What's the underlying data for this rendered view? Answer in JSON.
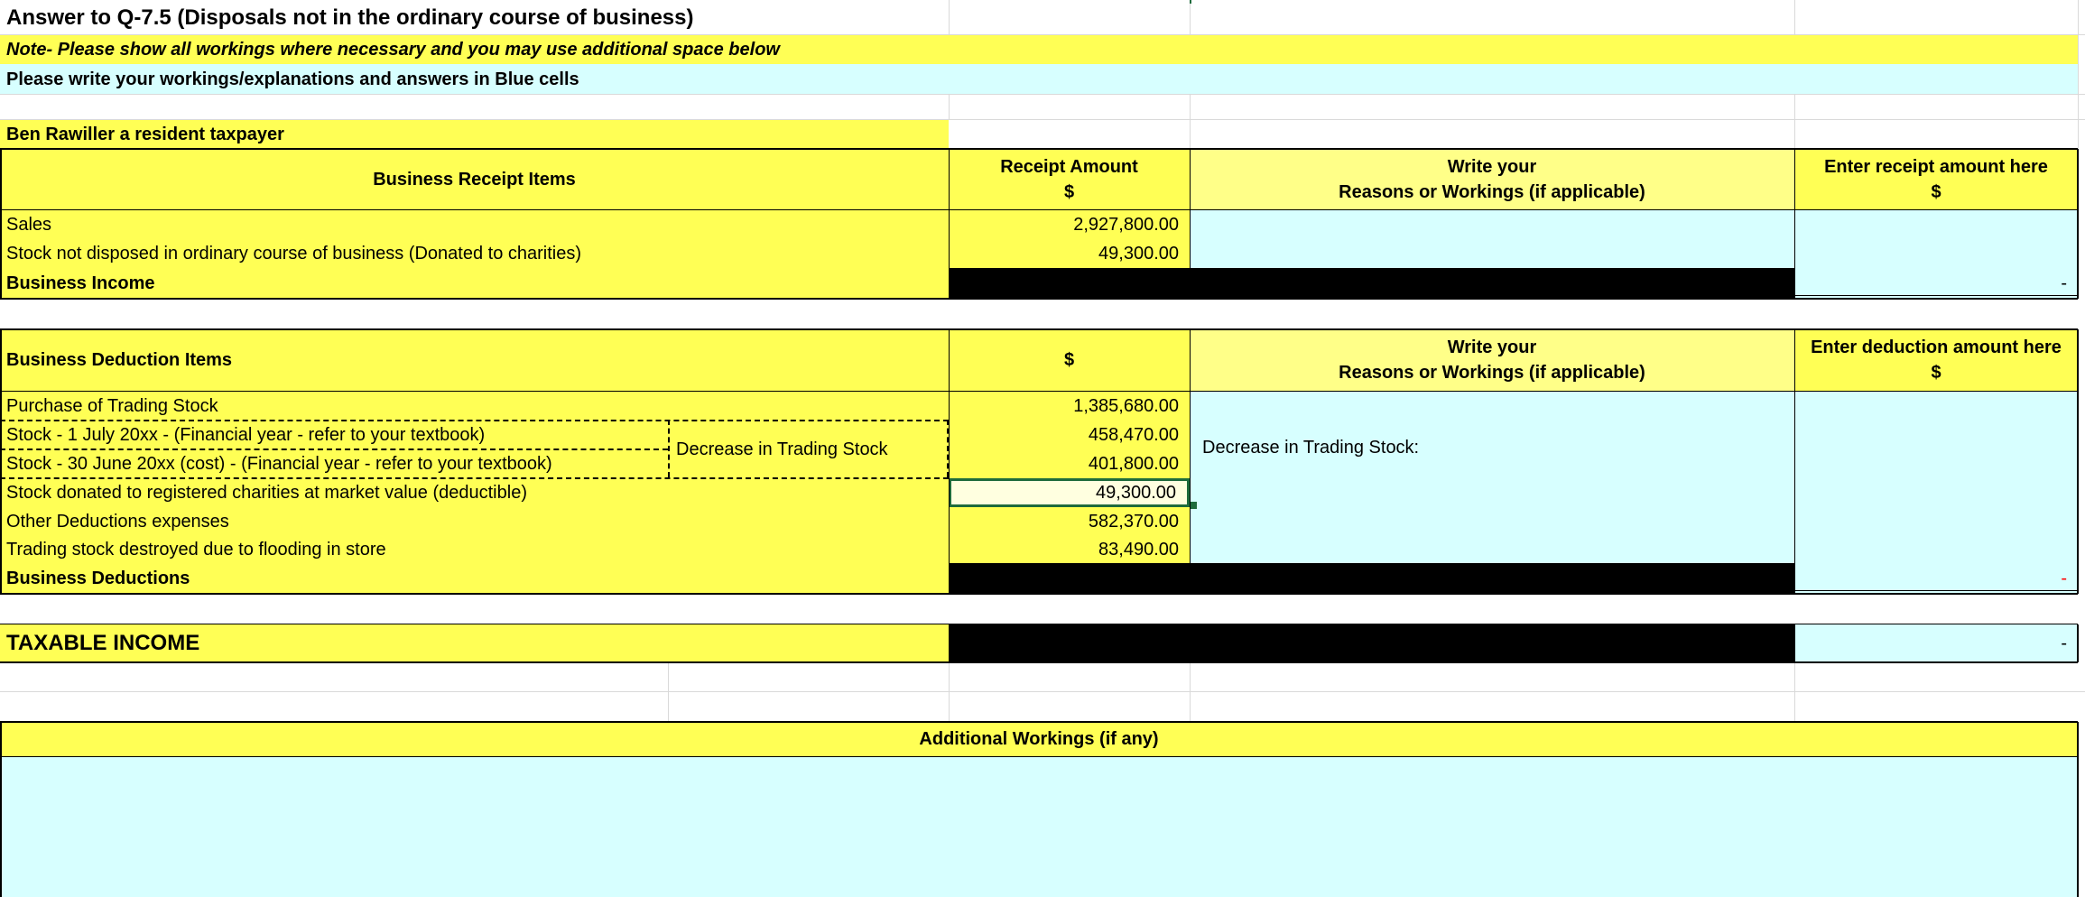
{
  "header": {
    "title": "Answer to Q-7.5 (Disposals not in the ordinary course of business)",
    "note": "Note- Please show all workings where necessary and you may use additional space below",
    "instruction": "Please write your workings/explanations and answers in Blue cells"
  },
  "taxpayer": "Ben Rawiller a resident taxpayer",
  "receipts": {
    "col_items": "Business Receipt Items",
    "col_amount": [
      "Receipt Amount",
      "$"
    ],
    "col_reasons": [
      "Write your",
      "Reasons or Workings (if applicable)"
    ],
    "col_enter": [
      "Enter receipt amount here",
      "$"
    ],
    "rows": [
      {
        "label": "Sales",
        "amount": "2,927,800.00"
      },
      {
        "label": "Stock not disposed in ordinary course of business (Donated to charities)",
        "amount": "49,300.00"
      }
    ],
    "total_label": "Business Income",
    "total_value": "-"
  },
  "deductions": {
    "col_items": "Business Deduction Items",
    "col_amount": "$",
    "col_reasons": [
      "Write your",
      "Reasons or Workings (if applicable)"
    ],
    "col_enter": [
      "Enter deduction amount here",
      "$"
    ],
    "rows": [
      {
        "label": "Purchase of Trading Stock",
        "amount": "1,385,680.00"
      },
      {
        "label": "Stock - 1 July 20xx - (Financial year - refer to your textbook)",
        "amount": "458,470.00"
      },
      {
        "label": "Stock - 30 June 20xx (cost) - (Financial year - refer to your textbook)",
        "amount": "401,800.00"
      },
      {
        "label": "Stock donated to registered charities at market value (deductible)",
        "amount": "49,300.00"
      },
      {
        "label": "Other Deductions expenses",
        "amount": "582,370.00"
      },
      {
        "label": "Trading stock destroyed due to flooding in store",
        "amount": "83,490.00"
      }
    ],
    "decrease_label": "Decrease in Trading Stock",
    "decrease_working": "Decrease in Trading Stock:",
    "total_label": "Business Deductions",
    "total_value": "-"
  },
  "taxable": {
    "label": "TAXABLE INCOME",
    "value": "-"
  },
  "additional": {
    "label": "Additional Workings (if any)"
  },
  "colors": {
    "yellow": "#ffff55",
    "blue": "#d7ffff",
    "black": "#000000"
  }
}
